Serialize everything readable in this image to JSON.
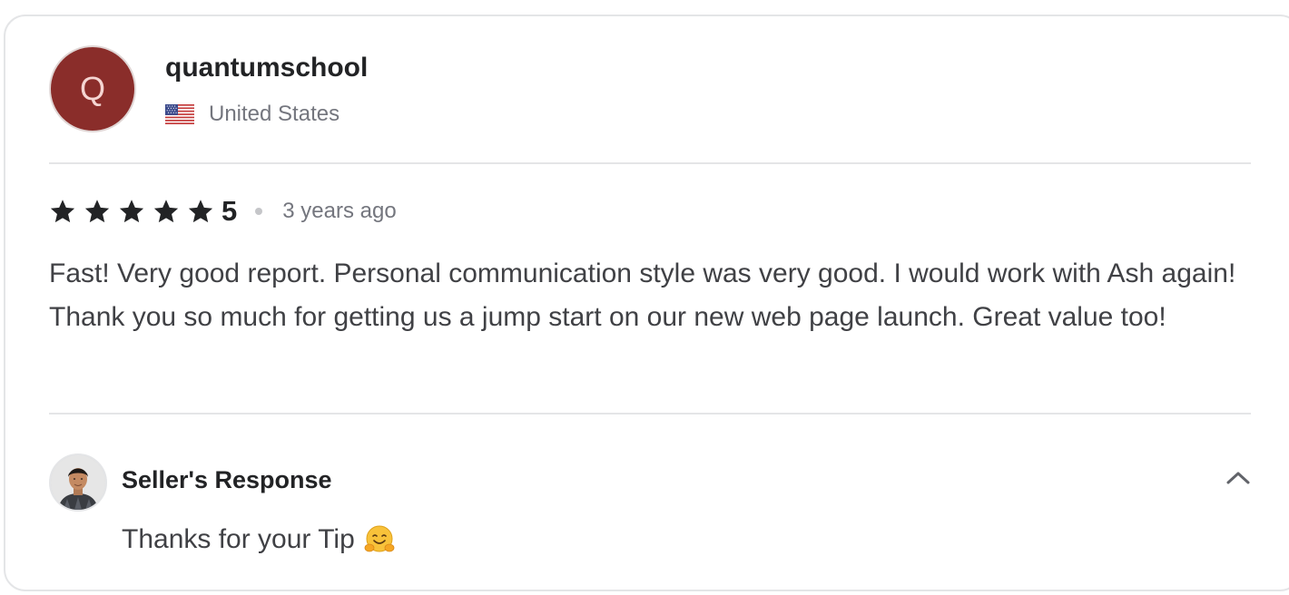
{
  "reviewer": {
    "initial": "Q",
    "username": "quantumschool",
    "country": "United States",
    "flag_icon": "us-flag-icon",
    "avatar_color": "#8a2d2a"
  },
  "review": {
    "rating": 5,
    "rating_label": "5",
    "max_stars": 5,
    "time_ago": "3 years ago",
    "text": "Fast! Very good report. Personal communication style was very good. I would work with Ash again! Thank you so much for getting us a jump start on our new web page launch. Great value too!"
  },
  "seller_response": {
    "title": "Seller's Response",
    "text": "Thanks for your Tip",
    "emoji_icon": "hugging-face-emoji-icon",
    "toggle_icon": "chevron-up-icon"
  },
  "colors": {
    "star": "#222325",
    "text": "#404145",
    "muted": "#74767e",
    "divider": "#e4e5e7"
  }
}
